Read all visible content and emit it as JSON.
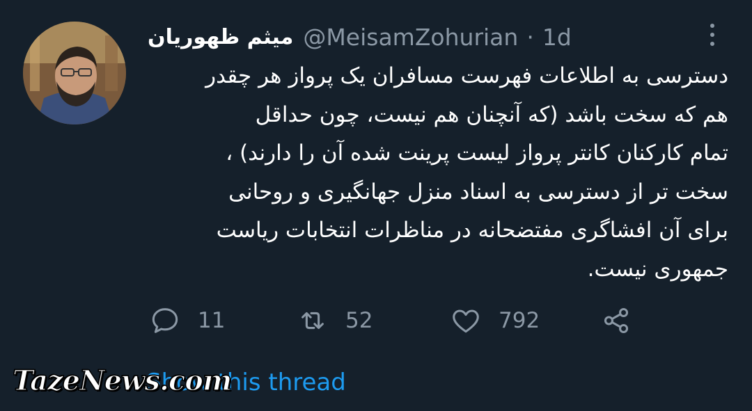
{
  "tweet": {
    "author": {
      "display_name": "میثم ظهوریان",
      "handle": "@MeisamZohurian",
      "separator": "·",
      "time": "1d"
    },
    "text_lines": [
      "دسترسی به اطلاعات فهرست مسافران یک پرواز هر چقدر",
      "هم که سخت باشد (که آنچنان هم نیست، چون حداقل",
      "تمام کارکنان کانتر پرواز لیست پرینت شده آن را دارند) ،",
      "سخت تر از دسترسی به اسناد منزل جهانگیری و روحانی",
      "برای آن افشاگری مفتضحانه در مناظرات انتخابات ریاست",
      "جمهوری نیست."
    ],
    "actions": {
      "reply": {
        "icon": "reply-icon",
        "count": "11"
      },
      "retweet": {
        "icon": "retweet-icon",
        "count": "52"
      },
      "like": {
        "icon": "heart-icon",
        "count": "792"
      },
      "share": {
        "icon": "share-icon"
      }
    },
    "show_thread": "Show this thread"
  },
  "watermark": "TazeNews.com",
  "colors": {
    "background": "#15202b",
    "text": "#ffffff",
    "secondary": "#8b98a5",
    "link": "#1d9bf0"
  }
}
